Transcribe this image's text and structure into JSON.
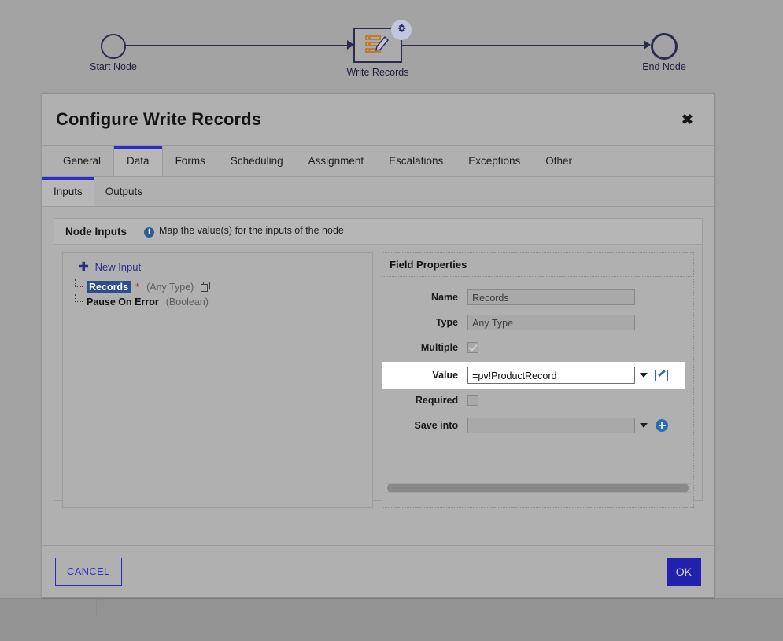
{
  "flow": {
    "start_node_label": "Start Node",
    "write_node_label": "Write Records",
    "end_node_label": "End Node"
  },
  "dialog": {
    "title": "Configure Write Records",
    "close_label": "✖"
  },
  "tabs_main": [
    {
      "label": "General",
      "active": false
    },
    {
      "label": "Data",
      "active": true
    },
    {
      "label": "Forms",
      "active": false
    },
    {
      "label": "Scheduling",
      "active": false
    },
    {
      "label": "Assignment",
      "active": false
    },
    {
      "label": "Escalations",
      "active": false
    },
    {
      "label": "Exceptions",
      "active": false
    },
    {
      "label": "Other",
      "active": false
    }
  ],
  "tabs_sub": [
    {
      "label": "Inputs",
      "active": true
    },
    {
      "label": "Outputs",
      "active": false
    }
  ],
  "node_inputs": {
    "title": "Node Inputs",
    "hint": "Map the value(s) for the inputs of the node",
    "info_glyph": "i",
    "new_input_label": "New Input",
    "new_input_glyph": "✚",
    "items": [
      {
        "name": "Records",
        "required": "*",
        "type": "(Any Type)",
        "selected": true,
        "has_copy": true
      },
      {
        "name": "Pause On Error",
        "required": "",
        "type": "(Boolean)",
        "selected": false,
        "has_copy": false
      }
    ]
  },
  "field_properties": {
    "title": "Field Properties",
    "name_label": "Name",
    "name_value": "Records",
    "type_label": "Type",
    "type_value": "Any Type",
    "multiple_label": "Multiple",
    "multiple_checked": true,
    "value_label": "Value",
    "value_value": "=pv!ProductRecord",
    "required_label": "Required",
    "required_checked": false,
    "save_into_label": "Save into",
    "save_into_value": ""
  },
  "footer": {
    "cancel_label": "CANCEL",
    "ok_label": "OK"
  },
  "colors": {
    "accent_blue": "#2b2bcc",
    "ok_button_bg": "#2121ad",
    "link_blue": "#2b2b8c",
    "selection_blue": "#2b4f8e",
    "required_red": "#cc2a2a",
    "icon_blue": "#2b6eab",
    "node_stroke": "#2b2b4e",
    "node_icon_orange": "#c07b3a",
    "dialog_bg": "#b0b0b0",
    "canvas_bg": "#a3a3a3"
  }
}
